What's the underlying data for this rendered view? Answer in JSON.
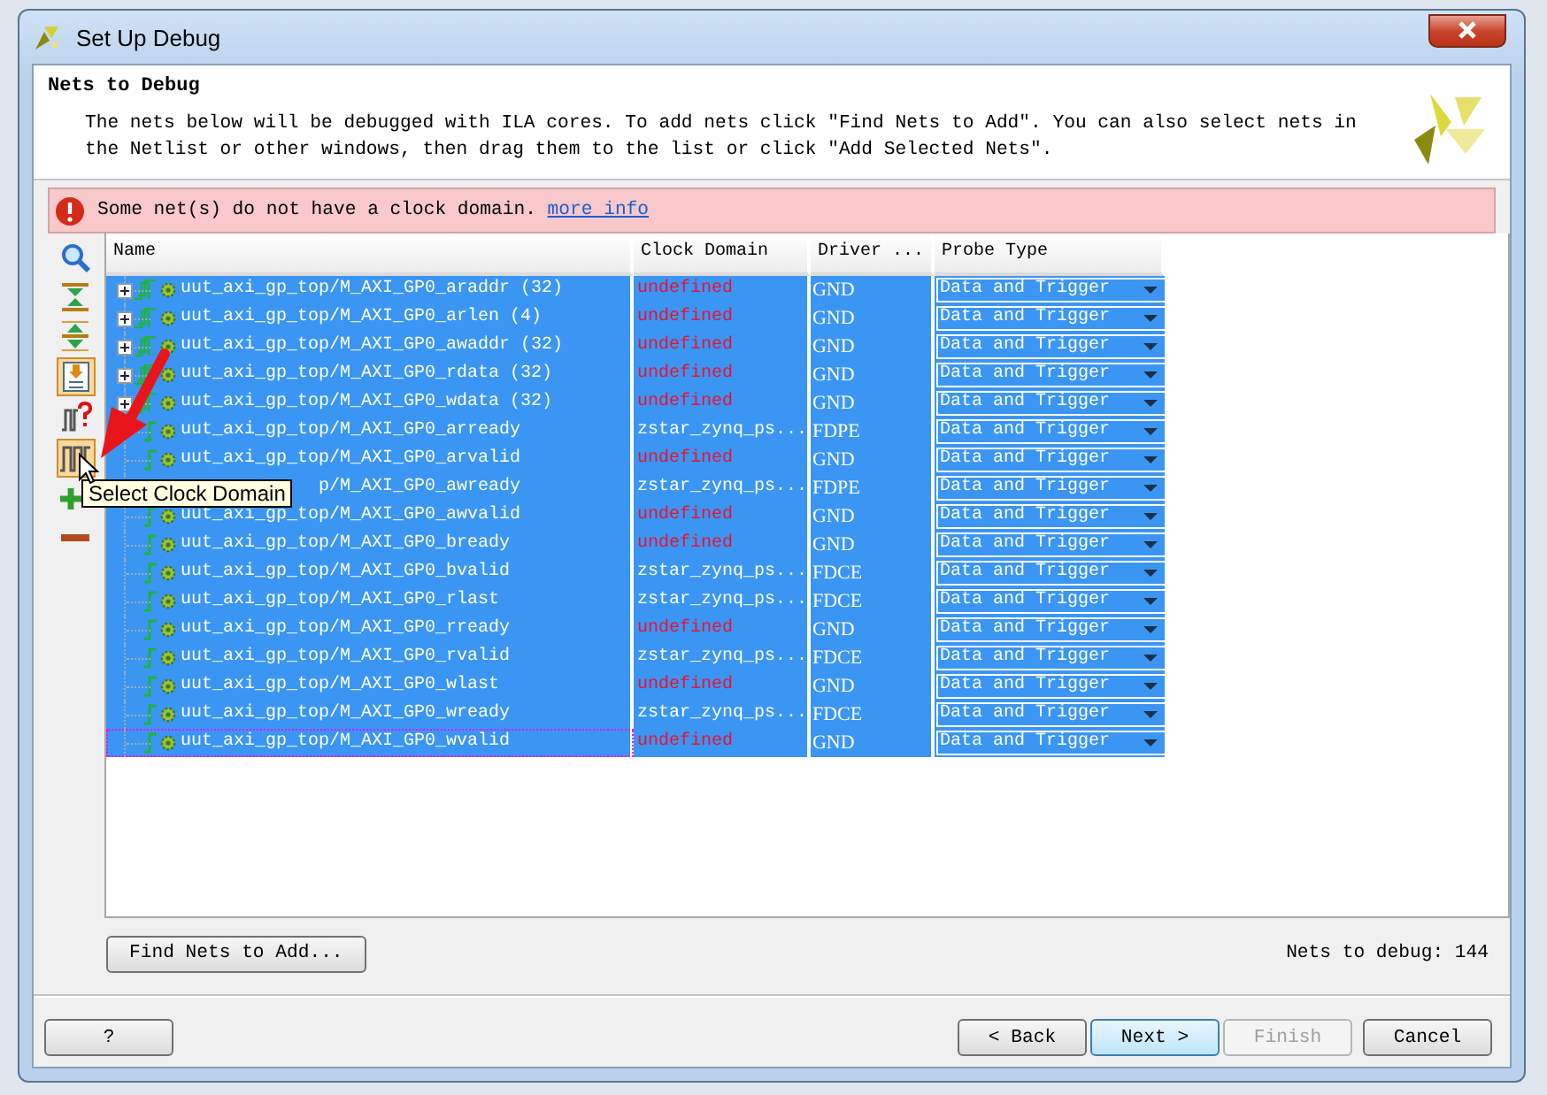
{
  "window": {
    "title": "Set Up Debug"
  },
  "header": {
    "title": "Nets to Debug",
    "description": "The nets below will be debugged with ILA cores. To add nets click \"Find Nets to Add\". You can also select nets in the Netlist or other windows, then drag them to the list or click \"Add Selected Nets\"."
  },
  "alert": {
    "message": "Some net(s) do not have a clock domain.",
    "link": "more info"
  },
  "toolbar": [
    {
      "kind": "search",
      "pressed": false
    },
    {
      "kind": "collapse",
      "pressed": false
    },
    {
      "kind": "expand",
      "pressed": false
    },
    {
      "kind": "add-selected",
      "pressed": true
    },
    {
      "kind": "unknown-net",
      "pressed": false
    },
    {
      "kind": "clock",
      "pressed": true
    },
    {
      "kind": "add",
      "pressed": false
    },
    {
      "kind": "remove",
      "pressed": false
    }
  ],
  "table": {
    "columns": [
      "Name",
      "Clock Domain",
      "Driver ...",
      "Probe Type"
    ],
    "rows": [
      {
        "kind": "bus",
        "name": "uut_axi_gp_top/M_AXI_GP0_araddr (32)",
        "clock_domain": "undefined",
        "clock_defined": false,
        "driver": "GND",
        "probe_type": "Data and Trigger",
        "selected": true,
        "focused": false
      },
      {
        "kind": "bus",
        "name": "uut_axi_gp_top/M_AXI_GP0_arlen (4)",
        "clock_domain": "undefined",
        "clock_defined": false,
        "driver": "GND",
        "probe_type": "Data and Trigger",
        "selected": true,
        "focused": false
      },
      {
        "kind": "bus",
        "name": "uut_axi_gp_top/M_AXI_GP0_awaddr (32)",
        "clock_domain": "undefined",
        "clock_defined": false,
        "driver": "GND",
        "probe_type": "Data and Trigger",
        "selected": true,
        "focused": false
      },
      {
        "kind": "bus",
        "name": "uut_axi_gp_top/M_AXI_GP0_rdata (32)",
        "clock_domain": "undefined",
        "clock_defined": false,
        "driver": "GND",
        "probe_type": "Data and Trigger",
        "selected": true,
        "focused": false
      },
      {
        "kind": "bus",
        "name": "uut_axi_gp_top/M_AXI_GP0_wdata (32)",
        "clock_domain": "undefined",
        "clock_defined": false,
        "driver": "GND",
        "probe_type": "Data and Trigger",
        "selected": true,
        "focused": false
      },
      {
        "kind": "net",
        "name": "uut_axi_gp_top/M_AXI_GP0_arready",
        "clock_domain": "zstar_zynq_ps...",
        "clock_defined": true,
        "driver": "FDPE",
        "probe_type": "Data and Trigger",
        "selected": true,
        "focused": false
      },
      {
        "kind": "net",
        "name": "uut_axi_gp_top/M_AXI_GP0_arvalid",
        "clock_domain": "undefined",
        "clock_defined": false,
        "driver": "GND",
        "probe_type": "Data and Trigger",
        "selected": true,
        "focused": false
      },
      {
        "kind": "net",
        "name": "p/M_AXI_GP0_awready",
        "clock_domain": "zstar_zynq_ps...",
        "clock_defined": true,
        "driver": "FDPE",
        "probe_type": "Data and Trigger",
        "selected": true,
        "focused": false
      },
      {
        "kind": "net",
        "name": "uut_axi_gp_top/M_AXI_GP0_awvalid",
        "clock_domain": "undefined",
        "clock_defined": false,
        "driver": "GND",
        "probe_type": "Data and Trigger",
        "selected": true,
        "focused": false
      },
      {
        "kind": "net",
        "name": "uut_axi_gp_top/M_AXI_GP0_bready",
        "clock_domain": "undefined",
        "clock_defined": false,
        "driver": "GND",
        "probe_type": "Data and Trigger",
        "selected": true,
        "focused": false
      },
      {
        "kind": "net",
        "name": "uut_axi_gp_top/M_AXI_GP0_bvalid",
        "clock_domain": "zstar_zynq_ps...",
        "clock_defined": true,
        "driver": "FDCE",
        "probe_type": "Data and Trigger",
        "selected": true,
        "focused": false
      },
      {
        "kind": "net",
        "name": "uut_axi_gp_top/M_AXI_GP0_rlast",
        "clock_domain": "zstar_zynq_ps...",
        "clock_defined": true,
        "driver": "FDCE",
        "probe_type": "Data and Trigger",
        "selected": true,
        "focused": false
      },
      {
        "kind": "net",
        "name": "uut_axi_gp_top/M_AXI_GP0_rready",
        "clock_domain": "undefined",
        "clock_defined": false,
        "driver": "GND",
        "probe_type": "Data and Trigger",
        "selected": true,
        "focused": false
      },
      {
        "kind": "net",
        "name": "uut_axi_gp_top/M_AXI_GP0_rvalid",
        "clock_domain": "zstar_zynq_ps...",
        "clock_defined": true,
        "driver": "FDCE",
        "probe_type": "Data and Trigger",
        "selected": true,
        "focused": false
      },
      {
        "kind": "net",
        "name": "uut_axi_gp_top/M_AXI_GP0_wlast",
        "clock_domain": "undefined",
        "clock_defined": false,
        "driver": "GND",
        "probe_type": "Data and Trigger",
        "selected": true,
        "focused": false
      },
      {
        "kind": "net",
        "name": "uut_axi_gp_top/M_AXI_GP0_wready",
        "clock_domain": "zstar_zynq_ps...",
        "clock_defined": true,
        "driver": "FDCE",
        "probe_type": "Data and Trigger",
        "selected": true,
        "focused": false
      },
      {
        "kind": "net",
        "name": "uut_axi_gp_top/M_AXI_GP0_wvalid",
        "clock_domain": "undefined",
        "clock_defined": false,
        "driver": "GND",
        "probe_type": "Data and Trigger",
        "selected": true,
        "focused": true
      }
    ]
  },
  "tooltip": "Select Clock Domain",
  "find_button": "Find Nets to Add...",
  "count": "Nets to debug: 144",
  "buttons": [
    {
      "kind": "help",
      "label": "?",
      "disabled": false,
      "default": false
    },
    {
      "kind": "nav",
      "label": "< Back",
      "disabled": false,
      "default": false
    },
    {
      "kind": "nav",
      "label": "Next >",
      "disabled": false,
      "default": true
    },
    {
      "kind": "nav",
      "label": "Finish",
      "disabled": true,
      "default": false
    },
    {
      "kind": "nav",
      "label": "Cancel",
      "disabled": false,
      "default": false
    }
  ]
}
